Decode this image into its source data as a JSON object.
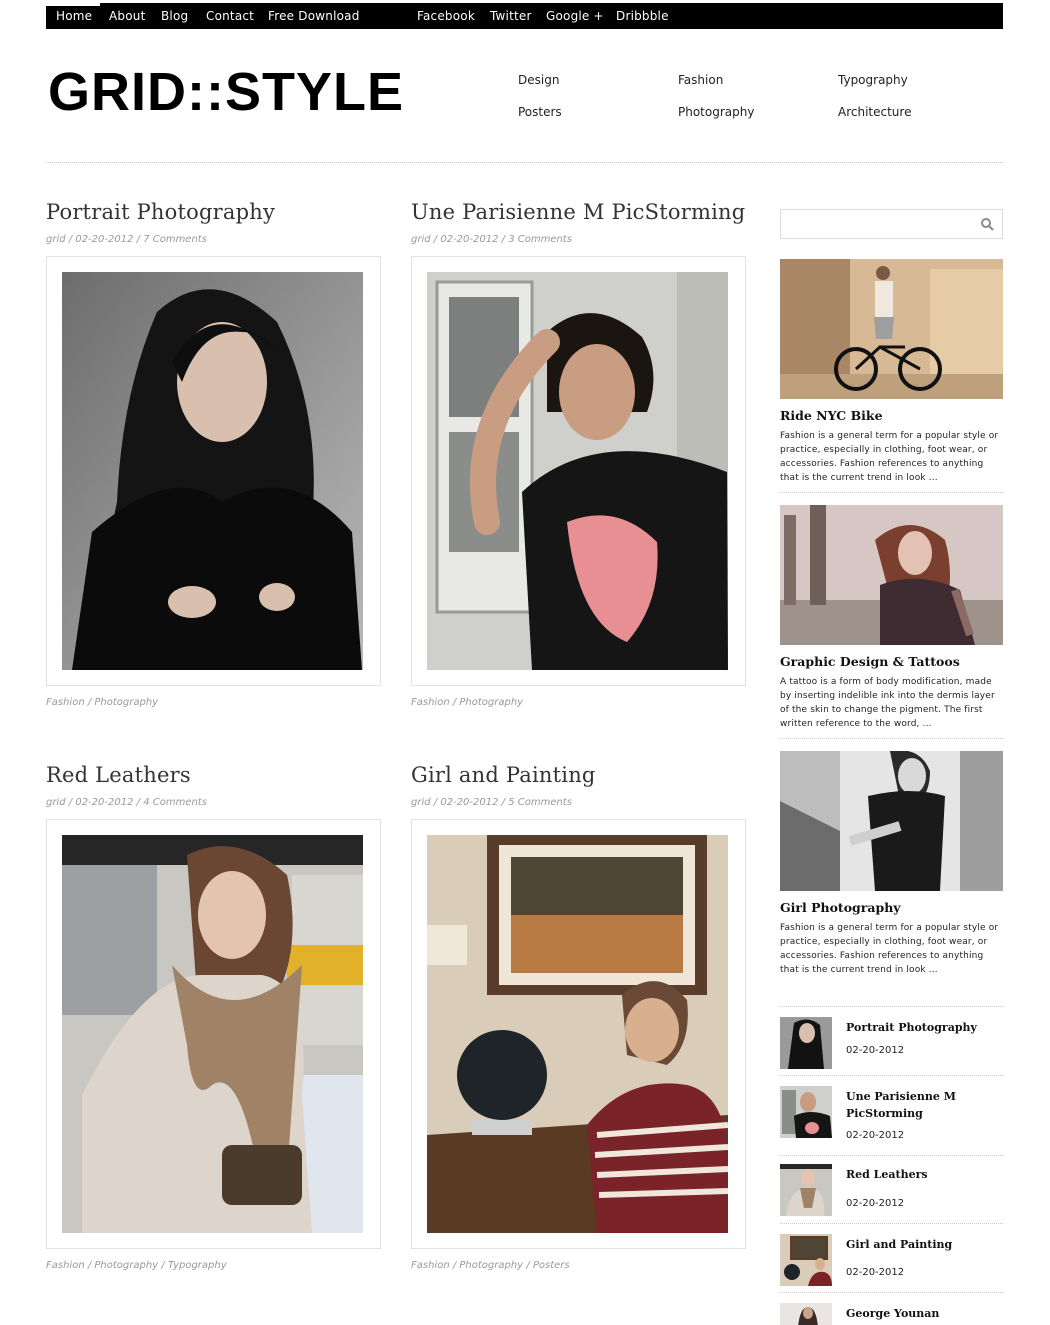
{
  "topnav": {
    "items": [
      "Home",
      "About",
      "Blog",
      "Contact",
      "Free Download"
    ],
    "social": [
      "Facebook",
      "Twitter",
      "Google +",
      "Dribbble"
    ]
  },
  "logo": "GRID::STYLE",
  "categories": [
    "Design",
    "Fashion",
    "Typography",
    "Posters",
    "Photography",
    "Architecture"
  ],
  "posts": [
    {
      "title": "Portrait Photography",
      "author": "grid",
      "date": "02-20-2012",
      "comments": "7 Comments",
      "tags": "Fashion / Photography"
    },
    {
      "title": "Une Parisienne M PicStorming",
      "author": "grid",
      "date": "02-20-2012",
      "comments": "3 Comments",
      "tags": "Fashion / Photography"
    },
    {
      "title": "Red Leathers",
      "author": "grid",
      "date": "02-20-2012",
      "comments": "4 Comments",
      "tags": "Fashion / Photography / Typography"
    },
    {
      "title": "Girl and Painting",
      "author": "grid",
      "date": "02-20-2012",
      "comments": "5 Comments",
      "tags": "Fashion / Photography / Posters"
    }
  ],
  "search": {
    "placeholder": ""
  },
  "featured": [
    {
      "title": "Ride NYC Bike",
      "desc": "Fashion is a general term for a popular style or practice, especially in clothing, foot wear, or accessories. Fashion references to anything that is the current trend in look ..."
    },
    {
      "title": "Graphic Design & Tattoos",
      "desc": "A tattoo is a form of body modification, made by inserting indelible ink into the dermis layer of the skin to change the pigment. The first written reference to the word, ..."
    },
    {
      "title": "Girl Photography",
      "desc": "Fashion is a general term for a popular style or practice, especially in clothing, foot wear, or accessories. Fashion references to anything that is the current trend in look ..."
    }
  ],
  "recent": [
    {
      "title": "Portrait Photography",
      "date": "02-20-2012"
    },
    {
      "title": "Une Parisienne M PicStorming",
      "date": "02-20-2012"
    },
    {
      "title": "Red Leathers",
      "date": "02-20-2012"
    },
    {
      "title": "Girl and Painting",
      "date": "02-20-2012"
    },
    {
      "title": "George Younan",
      "date": ""
    }
  ]
}
